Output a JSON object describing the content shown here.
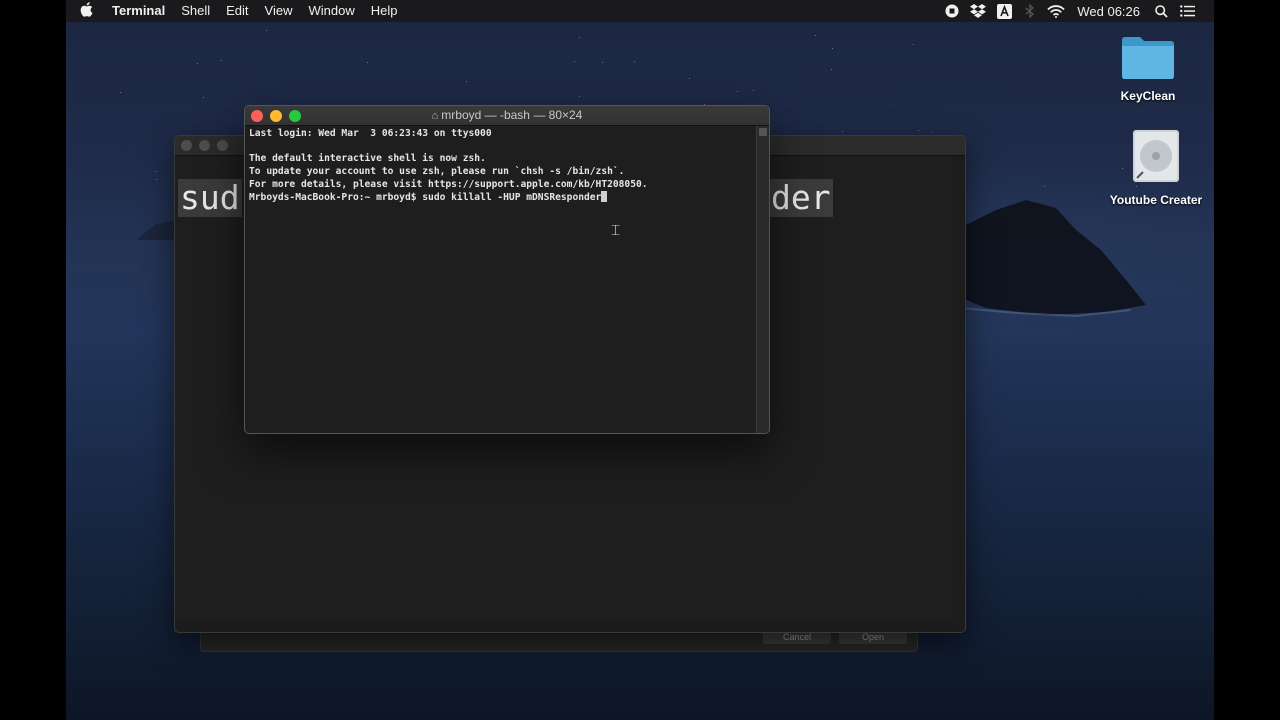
{
  "menubar": {
    "app_name": "Terminal",
    "items": [
      "Shell",
      "Edit",
      "View",
      "Window",
      "Help"
    ],
    "clock": "Wed 06:26"
  },
  "desktop": {
    "icons": [
      {
        "label": "KeyClean",
        "icon": "folder-icon"
      },
      {
        "label": "Youtube Creater",
        "icon": "drive-icon"
      }
    ]
  },
  "back_window": {
    "big_text_left": "sud",
    "big_text_right": "der",
    "sheet_buttons": [
      "Cancel",
      "Open"
    ]
  },
  "terminal": {
    "title": "mrboyd — -bash — 80×24",
    "lines": [
      "Last login: Wed Mar  3 06:23:43 on ttys000",
      "",
      "The default interactive shell is now zsh.",
      "To update your account to use zsh, please run `chsh -s /bin/zsh`.",
      "For more details, please visit https://support.apple.com/kb/HT208050.",
      "Mrboyds-MacBook-Pro:~ mrboyd$ sudo killall -HUP mDNSResponder"
    ]
  },
  "colors": {
    "close": "#ff5f57",
    "minimize": "#febc2e",
    "zoom": "#28c840",
    "terminal_bg": "#1e1e1e",
    "terminal_text": "#e6e6e6"
  }
}
